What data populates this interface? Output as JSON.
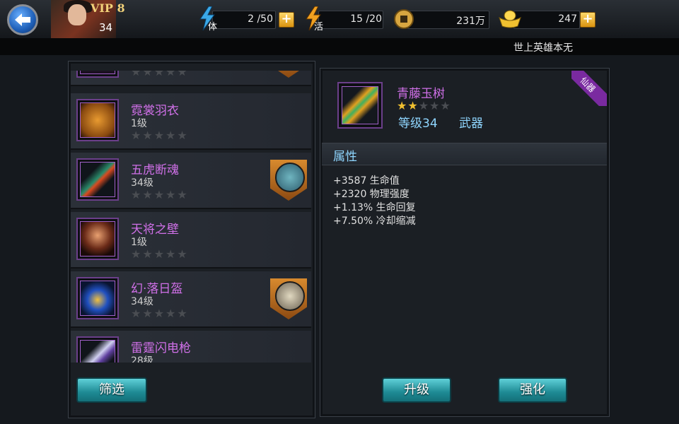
{
  "topbar": {
    "vip_label": "VIP 8",
    "player_level": "34",
    "stamina": {
      "label": "体",
      "value": "2 /50"
    },
    "energy": {
      "label": "活",
      "value": "15 /20"
    },
    "coins": {
      "value": "231万"
    },
    "gold": {
      "value": "247"
    },
    "plus_label": "+"
  },
  "title": "世上英雄本无",
  "colors": {
    "item_name": "#d070e8",
    "accent_blue": "#8fd6ff",
    "star_on": "#f0c030",
    "star_off": "#4a4d52",
    "button": "#1e8a94"
  },
  "equipment_list": [
    {
      "name": "",
      "level": "",
      "stars": "★★★★★",
      "has_badge": true,
      "icon": "robe-dark-icon"
    },
    {
      "name": "霓裳羽衣",
      "level": "1级",
      "stars": "★★★★★",
      "has_badge": false,
      "icon": "orange-robe-icon"
    },
    {
      "name": "五虎断魂",
      "level": "34级",
      "stars": "★★★★★",
      "has_badge": true,
      "icon": "spear-icon"
    },
    {
      "name": "天将之壁",
      "level": "1级",
      "stars": "★★★★★",
      "has_badge": false,
      "icon": "armor-icon"
    },
    {
      "name": "幻·落日盔",
      "level": "34级",
      "stars": "★★★★★",
      "has_badge": true,
      "icon": "helmet-icon"
    },
    {
      "name": "雷霆闪电枪",
      "level": "28级",
      "stars": "",
      "has_badge": false,
      "icon": "lightning-spear-icon"
    }
  ],
  "buttons": {
    "filter": "筛选",
    "upgrade": "升级",
    "enhance": "强化"
  },
  "selected_item": {
    "name": "青藤玉树",
    "stars_on": "★★",
    "stars_off": "★★★",
    "level": "等级34",
    "type": "武器",
    "ribbon": "仙器",
    "icon": "jade-spear-icon"
  },
  "attributes_title": "属性",
  "attributes": [
    "+3587 生命值",
    "+2320 物理强度",
    "+1.13% 生命回复",
    "+7.50% 冷却缩减"
  ]
}
